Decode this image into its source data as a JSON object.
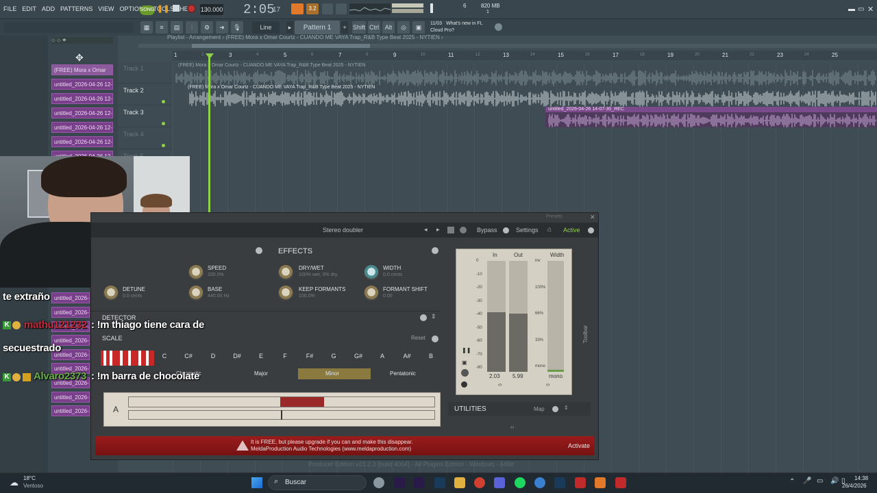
{
  "menu": [
    "FILE",
    "EDIT",
    "ADD",
    "PATTERNS",
    "VIEW",
    "OPTIONS",
    "TOOLS",
    "HELP"
  ],
  "transport": {
    "song_mode": "SONG",
    "tempo": "130.000",
    "time": "2:05",
    "time_sub": "17",
    "cpu": "6",
    "memory": "820 MB",
    "mem_sub": "1"
  },
  "toolbar": {
    "snap": "Line",
    "pattern": "Pattern 1",
    "shift": "Shift",
    "ctrl": "Ctrl",
    "alt": "Alt",
    "news_date": "11/03",
    "news_text": "What's new in FL",
    "news_text2": "Cloud Pro?"
  },
  "playlist": {
    "breadcrumb": "Playlist - Arrangement › (FREE) Mora x Omar Courtz - CUANDO ME VAYA Trap_R&B Type Beat 2025 - NYTIEN ›",
    "ruler": [
      "1",
      "3",
      "5",
      "7",
      "9",
      "11",
      "13",
      "15",
      "17",
      "19",
      "21",
      "23",
      "25"
    ],
    "ruler_odd": [
      "2",
      "4",
      "6",
      "8",
      "10",
      "12",
      "14",
      "16",
      "18",
      "20",
      "22",
      "24"
    ],
    "tracks": [
      "Track 1",
      "Track 2",
      "Track 3",
      "Track 4",
      "Track 5"
    ],
    "clip1": "(FREE) Mora x Omar Courtz - CUANDO ME VAYA Trap_R&B Type Beat 2025 - NYTIEN",
    "clip2": "(FREE) Mora x Omar Courtz - CUANDO ME VAYA Trap_R&B Type Beat 2025 - NYTIEN",
    "clip3": "untitled_2026-04-26 14-07-30_REC"
  },
  "channels": [
    "(FREE) Mora x Omar",
    "untitled_2026-04-26 12-",
    "untitled_2026-04-26 12-",
    "untitled_2026-04-26 12-",
    "untitled_2026-04-26 12-",
    "untitled_2026-04-26 12-",
    "untitled_2026-04-26 12-",
    "untitled_2026-0",
    "untitled_2026-0",
    "untitled_2026-0",
    "untitled_2026-0",
    "untitled_2026-0",
    "untitled_2026-0",
    "untitled_2026-0",
    "untitled_2026-0",
    "untitled_2026-0",
    "untitled_2026-0",
    "untitled_2026-0",
    "untitled_2026-0"
  ],
  "plugin": {
    "presets": "Presets",
    "name": "Stereo doubler",
    "bypass": "Bypass",
    "settings": "Settings",
    "active": "Active",
    "effects": "EFFECTS",
    "speed": "SPEED",
    "speed_val": "100.0%",
    "base": "BASE",
    "base_val": "440.00 Hz",
    "detune": "DETUNE",
    "detune_val": "0.0 cents",
    "drywet": "DRY/WET",
    "drywet_val": "100% wet, 0% dry",
    "width": "WIDTH",
    "width_val": "0.0 cents",
    "keepformants": "KEEP FORMANTS",
    "keepformants_val": "100.0%",
    "formantshift": "FORMANT SHIFT",
    "formantshift_val": "0.00",
    "detector": "DETECTOR",
    "scale": "SCALE",
    "reset": "Reset",
    "keys": [
      "C",
      "C#",
      "D",
      "D#",
      "E",
      "F",
      "F#",
      "G",
      "G#",
      "A",
      "A#",
      "B"
    ],
    "modes": [
      "Chromatic",
      "Major",
      "Minor",
      "Pentatonic"
    ],
    "note": "A",
    "meter_in": "In",
    "meter_out": "Out",
    "meter_width": "Width",
    "db_ticks": [
      "0",
      "-10",
      "-20",
      "-30",
      "-40",
      "-50",
      "-60",
      "-70",
      "-80"
    ],
    "width_ticks": [
      "inv",
      "100%",
      "66%",
      "33%",
      "mono"
    ],
    "in_val": "2.03",
    "out_val": "5.99",
    "width_val2": "mono",
    "toolbar_label": "Toolbar",
    "utilities": "UTILITIES",
    "map": "Map",
    "banner1": "It is FREE, but please upgrade if you can and make this disappear.",
    "banner2": "MeldaProduction Audio Technologies (www.meldaproduction.com)",
    "activate": "Activate"
  },
  "chat": {
    "line1": "te extraño",
    "user1": "mathu121232",
    "msg1": ": !m thiago tiene cara de",
    "msg1b": "secuestrado",
    "user2": "Alvaro2373",
    "msg2": ": !m barra de chocolate"
  },
  "status_bar": "Producer Edition v21.2.3 [build 4004] - All Plugins Edition - Windows - 64Bit",
  "taskbar": {
    "temp": "18°C",
    "weather": "Ventoso",
    "search": "Buscar",
    "time": "14:38",
    "date": "26/4/2026"
  },
  "colors": {
    "accent_orange": "#e07a2a",
    "clip_purple": "#7a3f8a",
    "plugin_red": "#8a1a1a",
    "playhead_green": "#8fd14a"
  }
}
